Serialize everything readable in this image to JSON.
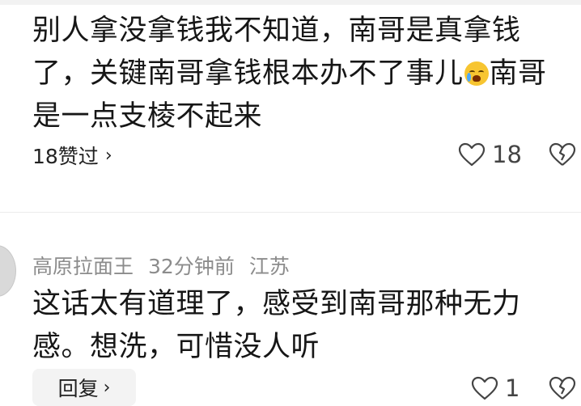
{
  "comment1": {
    "text_before_emoji": "别人拿没拿钱我不知道，南哥是真拿钱了，关键南哥拿钱根本办不了事儿",
    "text_after_emoji": "南哥是一点支棱不起来",
    "emoji": "crying-face-icon",
    "likes_summary": "18赞过",
    "like_count": "18"
  },
  "comment2": {
    "username": "高原拉面王",
    "time": "32分钟前",
    "location": "江苏",
    "text": "这话太有道理了，感受到南哥那种无力感。想洗，可惜没人听",
    "reply_label": "回复",
    "like_count": "1"
  },
  "colors": {
    "text": "#161616",
    "meta": "#8c8c8c",
    "button_bg": "#f3f3f3"
  }
}
